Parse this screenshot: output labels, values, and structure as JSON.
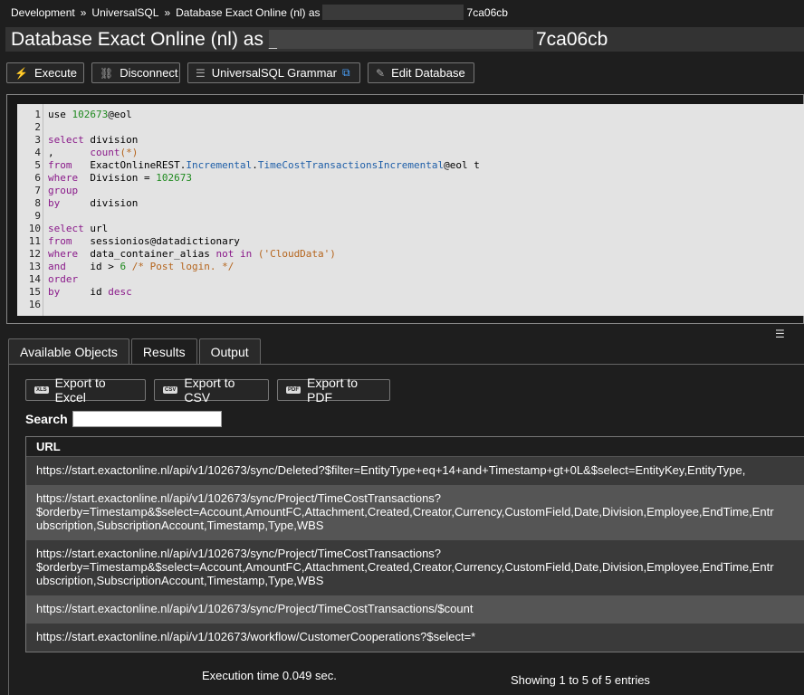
{
  "breadcrumb": {
    "items": [
      "Development",
      "UniversalSQL",
      "Database Exact Online (nl) as"
    ],
    "separator": "»",
    "suffix": "7ca06cb"
  },
  "title": {
    "prefix": "Database Exact Online (nl) as",
    "underscore": "_",
    "suffix": "7ca06cb"
  },
  "toolbar": {
    "execute": "Execute",
    "disconnect": "Disconnect",
    "grammar": "UniversalSQL Grammar",
    "edit_database": "Edit Database"
  },
  "editor": {
    "line_numbers": [
      "1",
      "2",
      "3",
      "4",
      "5",
      "6",
      "7",
      "8",
      "9",
      "10",
      "11",
      "12",
      "13",
      "14",
      "15",
      "16"
    ]
  },
  "tabs": [
    "Available Objects",
    "Results",
    "Output"
  ],
  "export": {
    "excel": "Export to Excel",
    "excel_badge": "XLS",
    "csv": "Export to CSV",
    "csv_badge": "CSV",
    "pdf": "Export to PDF",
    "pdf_badge": "PDF"
  },
  "search": {
    "label": "Search",
    "value": ""
  },
  "table": {
    "header": "URL",
    "rows": [
      "https://start.exactonline.nl/api/v1/102673/sync/Deleted?$filter=EntityType+eq+14+and+Timestamp+gt+0L&$select=EntityKey,EntityType,",
      "https://start.exactonline.nl/api/v1/102673/sync/Project/TimeCostTransactions?\n$orderby=Timestamp&$select=Account,AmountFC,Attachment,Created,Creator,Currency,CustomField,Date,Division,Employee,EndTime,Entr\nubscription,SubscriptionAccount,Timestamp,Type,WBS",
      "https://start.exactonline.nl/api/v1/102673/sync/Project/TimeCostTransactions?\n$orderby=Timestamp&$select=Account,AmountFC,Attachment,Created,Creator,Currency,CustomField,Date,Division,Employee,EndTime,Entr\nubscription,SubscriptionAccount,Timestamp,Type,WBS",
      "https://start.exactonline.nl/api/v1/102673/sync/Project/TimeCostTransactions/$count",
      "https://start.exactonline.nl/api/v1/102673/workflow/CustomerCooperations?$select=*"
    ]
  },
  "footer": {
    "execution_time": "Execution time 0.049 sec.",
    "showing": "Showing 1 to 5 of 5 entries"
  },
  "icons": {
    "execute": "bolt-icon",
    "disconnect": "unlink-icon",
    "grammar": "database-icon",
    "grammar_ext": "external-link-icon",
    "edit_database": "edit-icon"
  }
}
